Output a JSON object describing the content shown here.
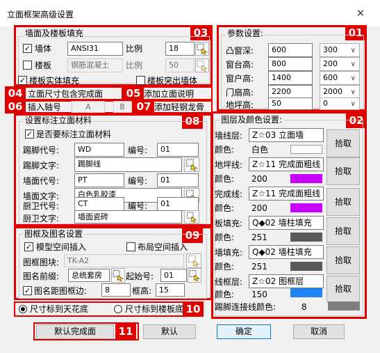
{
  "window": {
    "title": "立面框架高级设置",
    "close": "✕"
  },
  "tags": {
    "t01": "01",
    "t02": "02",
    "t03": "03",
    "t04": "04",
    "t05": "05",
    "t06": "06",
    "t07": "07",
    "t08": "08",
    "t09": "09",
    "t10": "10",
    "t11": "11"
  },
  "wall_group": {
    "legend": "墙面及楼板填充",
    "wall_label": "墙体",
    "wall_checked": true,
    "wall_pattern": "ANSI31",
    "wall_scale_label": "比例",
    "wall_scale": "18",
    "slab_label": "楼板",
    "slab_checked": false,
    "slab_pattern": "钢筋混凝土",
    "slab_scale_label": "比例",
    "slab_scale": "50",
    "slab_solid_label": "楼板实体填充",
    "slab_solid_checked": true,
    "slab_protrude_label": "楼板突出墙体",
    "slab_protrude_checked": false
  },
  "misc": {
    "include_face_label": "立面尺寸包含完成面",
    "add_desc_label": "添加立面说明",
    "axis_label": "插入轴号",
    "axis_a": "A",
    "axis_b": "B",
    "add_keel_label": "添加轻钢龙骨"
  },
  "params": {
    "legend": "参数设置:",
    "rows": [
      {
        "label": "凸窗深:",
        "value": "600",
        "option": "300"
      },
      {
        "label": "窗台高:",
        "value": "800",
        "option": "200"
      },
      {
        "label": "窗户高:",
        "value": "1400",
        "option": "600"
      },
      {
        "label": "门扇高:",
        "value": "2200",
        "option": "2000"
      },
      {
        "label": "地坪高:",
        "value": "50",
        "option": "0"
      }
    ]
  },
  "layers": {
    "legend": "图层及颜色设置:",
    "color_label": "颜色:",
    "pick_label": "拾取",
    "rows": [
      {
        "label": "墙线层:",
        "layer": "Z☆03 立面墙",
        "color_num": "白色",
        "color": "#ffffff"
      },
      {
        "label": "地坪线:",
        "layer": "Z☆11 完成面粗线",
        "color_num": "200",
        "color": "#c800ff"
      },
      {
        "label": "完成线:",
        "layer": "Z☆11 完成面粗线",
        "color_num": "200",
        "color": "#c800ff"
      },
      {
        "label": "板填充:",
        "layer": "Q◆02 墙柱填充",
        "color_num": "251",
        "color": "#5a5a5a"
      },
      {
        "label": "墙填充:",
        "layer": "Q◆02 墙柱填充",
        "color_num": "251",
        "color": "#5a5a5a"
      },
      {
        "label": "线框层:",
        "layer": "Z☆02 图框层",
        "color_num": "150",
        "color": "#1f83f0"
      }
    ],
    "kick_label": "踢脚连接线颜色:",
    "kick_num": "8",
    "kick_color": "#808080"
  },
  "material": {
    "legend": "设置标注立面材料",
    "need_label": "是否要标注立面材料",
    "need_checked": true,
    "code_label": "编号:",
    "rows": [
      {
        "code_label": "踢脚代号:",
        "code": "WD",
        "num": "01",
        "text_label": "踢脚文字:",
        "text": "踢脚线"
      },
      {
        "code_label": "墙面代号:",
        "code": "PT",
        "num": "01",
        "text_label": "墙面文字:",
        "text": "白色乳胶漆"
      },
      {
        "code_label": "厨卫代号:",
        "code": "CT",
        "num": "01",
        "text_label": "厨卫文字:",
        "text": "墙面瓷砖"
      }
    ]
  },
  "frame": {
    "legend": "图框及图名设置",
    "model_label": "模型空间插入",
    "model_checked": true,
    "layout_label": "布局空间插入",
    "layout_checked": false,
    "block_label": "图框图块:",
    "block_value": "TK-A2",
    "prefix_label": "图名前缀:",
    "prefix_value": "总统套房",
    "start_label": "起始号:",
    "start_value": "01",
    "gap_label": "图名距图框边:",
    "gap_checked": true,
    "gap_value": "8",
    "height_label": "框高:",
    "height_value": "15"
  },
  "dims": {
    "ceiling_label": "尺寸标到天花底",
    "ceiling_selected": true,
    "slab_label": "尺寸标到楼板底",
    "slab_selected": false
  },
  "buttons": {
    "default_face": "默认完成面",
    "default": "默认",
    "ok": "确定",
    "cancel": "取消"
  }
}
